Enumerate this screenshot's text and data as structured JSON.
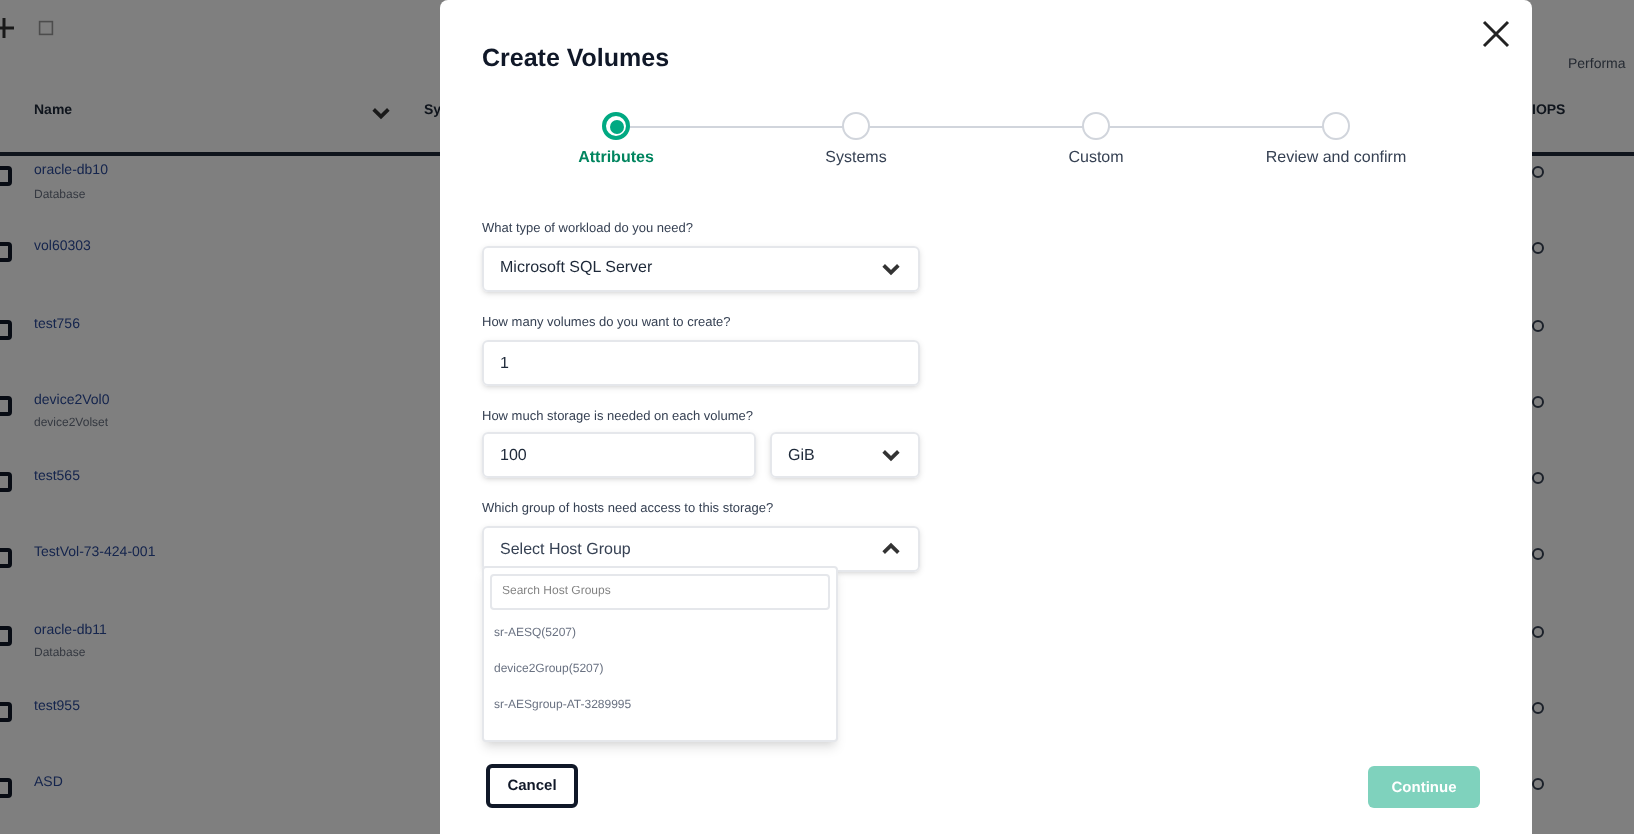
{
  "background_table": {
    "group_header": "Performa",
    "columns": [
      {
        "label": "Name",
        "sortable": true
      },
      {
        "label": "Sy"
      },
      {
        "label": "IOPS"
      }
    ],
    "rows": [
      {
        "name": "oracle-db10",
        "subtitle": "Database",
        "checked": false
      },
      {
        "name": "vol60303",
        "checked": false
      },
      {
        "name": "test756",
        "checked": false
      },
      {
        "name": "device2Vol0",
        "subtitle": "device2Volset",
        "checked": false
      },
      {
        "name": "test565",
        "checked": false
      },
      {
        "name": "TestVol-73-424-001",
        "checked": false
      },
      {
        "name": "oracle-db11",
        "subtitle": "Database",
        "checked": false
      },
      {
        "name": "test955",
        "checked": false
      },
      {
        "name": "ASD",
        "checked": false
      }
    ]
  },
  "dialog": {
    "title": "Create Volumes",
    "steps": [
      {
        "label": "Attributes",
        "selected": true
      },
      {
        "label": "Systems",
        "selected": false
      },
      {
        "label": "Custom",
        "selected": false
      },
      {
        "label": "Review and confirm",
        "selected": false
      }
    ],
    "fields": [
      {
        "kind": "select",
        "label": "What type of workload do you need?",
        "value": "Microsoft SQL Server",
        "expanded": false
      },
      {
        "kind": "input",
        "label": "How many volumes do you want to create?",
        "value": "1"
      },
      {
        "kind": "input_unit",
        "label": "How much storage is needed on each volume?",
        "value": "100",
        "unit": "GiB"
      },
      {
        "kind": "select",
        "label": "Which group of hosts need access to this storage?",
        "placeholder": "Select Host Group",
        "expanded": true,
        "dropdown": {
          "search_placeholder": "Search Host Groups",
          "options": [
            "sr-AESQ(5207)",
            "device2Group(5207)",
            "sr-AESgroup-AT-3289995"
          ]
        }
      }
    ],
    "buttons": [
      {
        "kind": "secondary",
        "label": "Cancel"
      },
      {
        "kind": "primary",
        "label": "Continue",
        "disabled": true
      }
    ]
  }
}
